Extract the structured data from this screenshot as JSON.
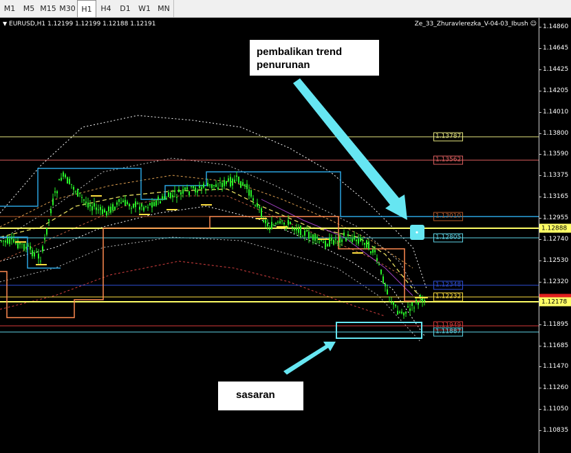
{
  "toolbar": {
    "timeframes": [
      "M1",
      "M5",
      "M15",
      "M30",
      "H1",
      "H4",
      "D1",
      "W1",
      "MN"
    ],
    "active": "H1"
  },
  "header": {
    "symbol_info": "EURUSD,H1  1.12199 1.12199 1.12188 1.12191",
    "indicator": "Ze_33_Zhuravlerezka_V-04-03_Ibush"
  },
  "price_axis": {
    "ticks": [
      "1.14860",
      "1.14645",
      "1.14425",
      "1.14205",
      "1.14010",
      "1.13800",
      "1.13590",
      "1.13375",
      "1.13165",
      "1.12955",
      "1.12740",
      "1.12530",
      "1.12320",
      "1.12105",
      "1.11895",
      "1.11685",
      "1.11470",
      "1.11260",
      "1.11050",
      "1.10835"
    ],
    "markers": [
      {
        "text": "1.12888",
        "bg": "#ffff66",
        "fg": "#000"
      },
      {
        "text": "1.12178",
        "bg": "#ffff66",
        "fg": "#000"
      },
      {
        "text": "",
        "bg": "#e02020",
        "fg": "#000"
      }
    ]
  },
  "levels": [
    {
      "label": "1.13787",
      "color": "#e8e880"
    },
    {
      "label": "1.13562",
      "color": "#e06060"
    },
    {
      "label": "1.13010",
      "color": "#b85a2a"
    },
    {
      "label": "1.12805",
      "color": "#5fd6e8"
    },
    {
      "label": "1.12348",
      "color": "#2e4fd8"
    },
    {
      "label": "1.12232",
      "color": "#ffe040"
    },
    {
      "label": "1.11949",
      "color": "#d83a3a"
    },
    {
      "label": "1.11887",
      "color": "#5fd6e8"
    }
  ],
  "annotations": {
    "reversal": "pembalikan trend\npenurunan",
    "target": "sasaran"
  },
  "colors": {
    "arrow": "#66e6f2",
    "candles": "#28f028",
    "bg": "#000000"
  }
}
